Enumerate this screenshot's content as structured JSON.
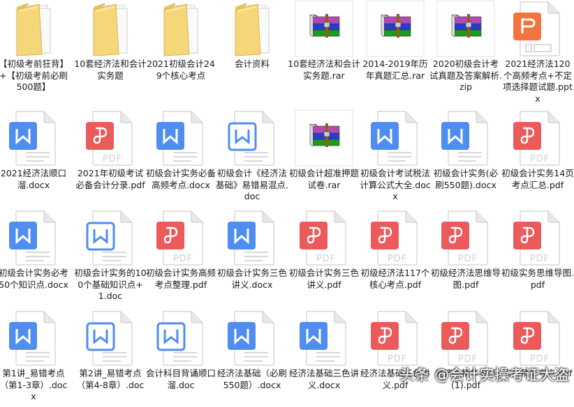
{
  "files": [
    {
      "name": "【初级考前狂背】+【初级考前必刷500题】",
      "type": "folder"
    },
    {
      "name": "10套经济法和会计实务题",
      "type": "folder"
    },
    {
      "name": "2021初级会计249个核心考点",
      "type": "folder"
    },
    {
      "name": "会计资料",
      "type": "folder"
    },
    {
      "name": "10套经济法和会计实务题.rar",
      "type": "rar"
    },
    {
      "name": "2014-2019年历年真题汇总.rar",
      "type": "rar"
    },
    {
      "name": "2020初级会计考试真题及答案解析.zip",
      "type": "rar"
    },
    {
      "name": "2021经济法120个高频考点+不定项选择题试题.pptx",
      "type": "pptx"
    },
    {
      "name": "2021经济法顺口溜.docx",
      "type": "docx"
    },
    {
      "name": "2021年初级考试必备会计分录.pdf",
      "type": "pdf"
    },
    {
      "name": "初级会计实务必备高频考点.docx",
      "type": "docx"
    },
    {
      "name": "初级会计《经济法基础》易错易混点.doc",
      "type": "doc"
    },
    {
      "name": "初级会计超准押题试卷.rar",
      "type": "rar"
    },
    {
      "name": "初级会计考试税法计算公式大全.docx",
      "type": "docx"
    },
    {
      "name": "初级会计实务(必刷550题).docx",
      "type": "docx"
    },
    {
      "name": "初级会计实务14页考点汇总.pdf",
      "type": "pdf"
    },
    {
      "name": "初级会计实务必考50个知识点.docx",
      "type": "docx"
    },
    {
      "name": "初级会计实务的100个基础知识点+1.doc",
      "type": "doc"
    },
    {
      "name": "初级会计实务高频考点整理.pdf",
      "type": "pdf"
    },
    {
      "name": "初级会计实务三色讲义.docx",
      "type": "docx"
    },
    {
      "name": "初级会计实务三色讲义.pdf",
      "type": "pdf"
    },
    {
      "name": "初级经济法117个核心考点.pdf",
      "type": "pdf"
    },
    {
      "name": "初级经济法思维导图.pdf",
      "type": "pdf"
    },
    {
      "name": "初级实务思维导图.pdf",
      "type": "pdf"
    },
    {
      "name": "第1讲_易错考点（第1-3章）.docx",
      "type": "docx"
    },
    {
      "name": "第2讲_易错考点（第4-8章）.doc",
      "type": "doc"
    },
    {
      "name": "会计科目背诵顺口溜.doc",
      "type": "doc"
    },
    {
      "name": "经济法基础（必刷550题）.docx",
      "type": "docx"
    },
    {
      "name": "经济法基础三色讲义.docx",
      "type": "docx"
    },
    {
      "name": "经济法基础三色讲义.pdf",
      "type": "pdf"
    },
    {
      "name": "经济法精华考点(1).pdf",
      "type": "pdf"
    },
    {
      "name": "实务精华考点.pdf",
      "type": "pdf"
    }
  ],
  "watermark": "头条 @会计实操考证大盗",
  "colors": {
    "word": "#4f8ef0",
    "pdf": "#ec5b5b",
    "ppt": "#f3733f",
    "folder": "#f5d77a"
  }
}
